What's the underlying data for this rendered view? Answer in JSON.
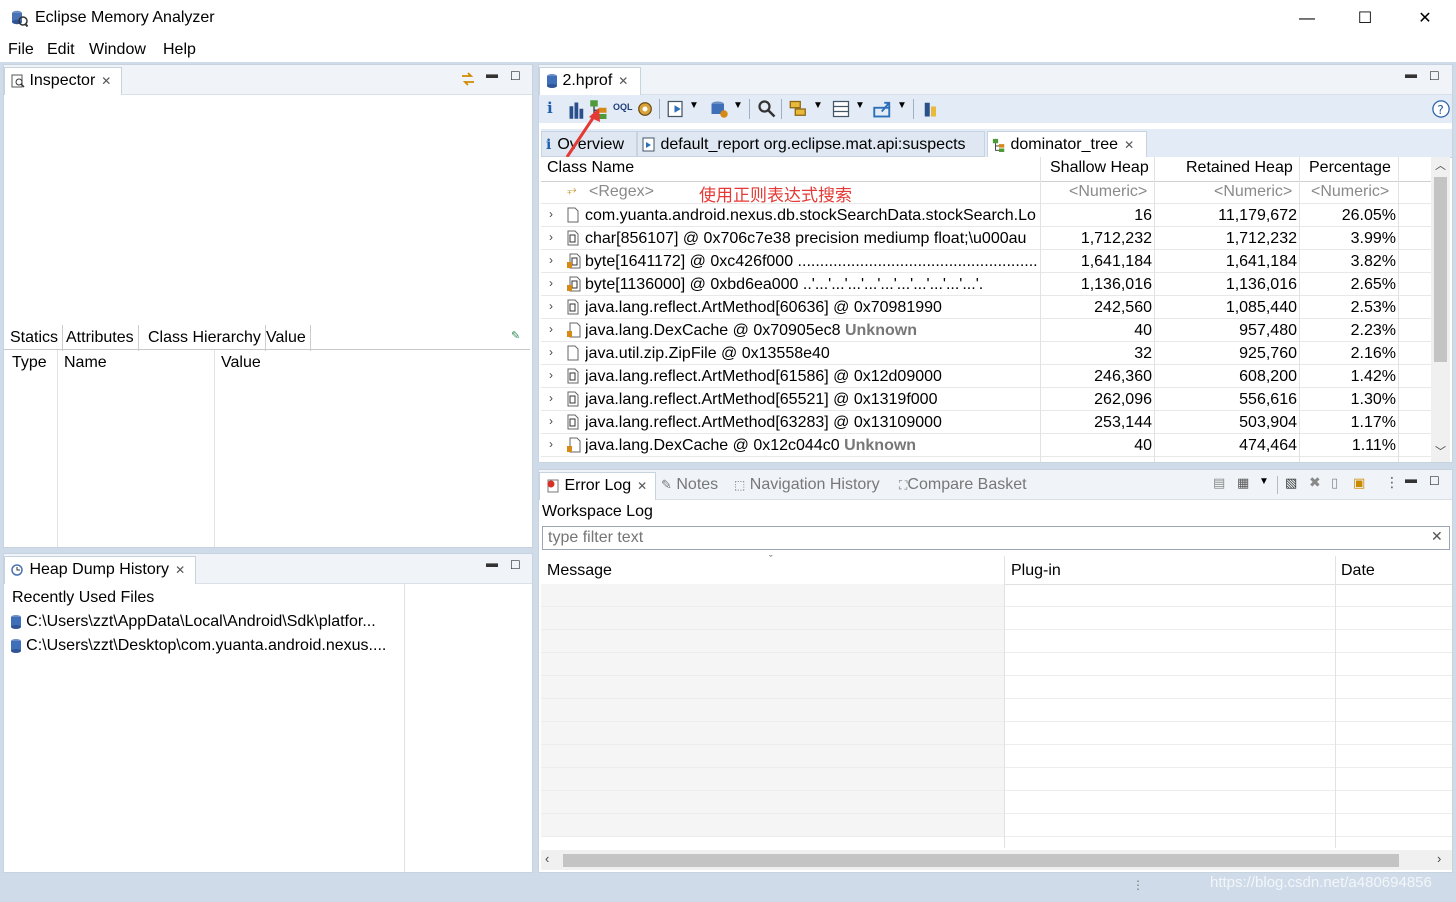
{
  "window": {
    "title": "Eclipse Memory Analyzer",
    "min": "—",
    "max": "☐",
    "close": "✕"
  },
  "menu": [
    "File",
    "Edit",
    "Window",
    "Help"
  ],
  "inspector": {
    "tab": "Inspector",
    "subtabs": [
      "Statics",
      "Attributes",
      "Class Hierarchy",
      "Value"
    ],
    "columns": [
      "Type",
      "Name",
      "Value"
    ]
  },
  "heap_history": {
    "tab": "Heap Dump History",
    "heading": "Recently Used Files",
    "files": [
      "C:\\Users\\zzt\\AppData\\Local\\Android\\Sdk\\platfor...",
      "C:\\Users\\zzt\\Desktop\\com.yuanta.android.nexus...."
    ]
  },
  "editor": {
    "tab": "2.hprof",
    "subtabs": [
      "Overview",
      "default_report  org.eclipse.mat.api:suspects",
      "dominator_tree"
    ],
    "annotation": "使用正则表达式搜索",
    "columns": [
      "Class Name",
      "Shallow Heap",
      "Retained Heap",
      "Percentage"
    ],
    "filters": [
      "<Regex>",
      "<Numeric>",
      "<Numeric>",
      "<Numeric>"
    ],
    "rows": [
      {
        "name": "com.yuanta.android.nexus.db.stockSearchData.stockSearch.Lo",
        "suffix": "",
        "shallow": "16",
        "retained": "11,179,672",
        "pct": "26.05%",
        "icon": "file"
      },
      {
        "name": "char[856107] @ 0x706c7e38  precision mediump float;\\u000au",
        "suffix": "",
        "shallow": "1,712,232",
        "retained": "1,712,232",
        "pct": "3.99%",
        "icon": "array"
      },
      {
        "name": "byte[1641172] @ 0xc426f000  .........................................................",
        "suffix": "",
        "shallow": "1,641,184",
        "retained": "1,641,184",
        "pct": "3.82%",
        "icon": "array-lock"
      },
      {
        "name": "byte[1136000] @ 0xbd6ea000  ..'...'...'...'...'...'...'...'...'...'...'.",
        "suffix": "",
        "shallow": "1,136,016",
        "retained": "1,136,016",
        "pct": "2.65%",
        "icon": "array-lock"
      },
      {
        "name": "java.lang.reflect.ArtMethod[60636] @ 0x70981990",
        "suffix": "",
        "shallow": "242,560",
        "retained": "1,085,440",
        "pct": "2.53%",
        "icon": "array"
      },
      {
        "name": "java.lang.DexCache @ 0x70905ec8 ",
        "suffix": "Unknown",
        "shallow": "40",
        "retained": "957,480",
        "pct": "2.23%",
        "icon": "file-lock"
      },
      {
        "name": "java.util.zip.ZipFile @ 0x13558e40",
        "suffix": "",
        "shallow": "32",
        "retained": "925,760",
        "pct": "2.16%",
        "icon": "file"
      },
      {
        "name": "java.lang.reflect.ArtMethod[61586] @ 0x12d09000",
        "suffix": "",
        "shallow": "246,360",
        "retained": "608,200",
        "pct": "1.42%",
        "icon": "array"
      },
      {
        "name": "java.lang.reflect.ArtMethod[65521] @ 0x1319f000",
        "suffix": "",
        "shallow": "262,096",
        "retained": "556,616",
        "pct": "1.30%",
        "icon": "array"
      },
      {
        "name": "java.lang.reflect.ArtMethod[63283] @ 0x13109000",
        "suffix": "",
        "shallow": "253,144",
        "retained": "503,904",
        "pct": "1.17%",
        "icon": "array"
      },
      {
        "name": "java.lang.DexCache @ 0x12c044c0 ",
        "suffix": "Unknown",
        "shallow": "40",
        "retained": "474,464",
        "pct": "1.11%",
        "icon": "file-lock"
      }
    ]
  },
  "bottom": {
    "tabs": [
      "Error Log",
      "Notes",
      "Navigation History",
      "Compare Basket"
    ],
    "heading": "Workspace Log",
    "filter_placeholder": "type filter text",
    "columns": [
      "Message",
      "Plug-in",
      "Date"
    ]
  },
  "watermark": "https://blog.csdn.net/a480694856",
  "colors": {
    "accent": "#1f6fb5",
    "annotation": "#e53935",
    "arrow": "#e53935"
  }
}
